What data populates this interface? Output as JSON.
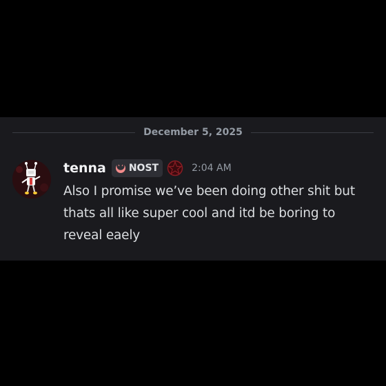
{
  "divider": {
    "date": "December 5, 2025"
  },
  "message": {
    "author": "tenna",
    "tag": {
      "label": "NOST",
      "icon": "crescent-moon-icon"
    },
    "role_icon": "pentagram-icon",
    "timestamp": "2:04 AM",
    "content": "Also I promise we’ve been doing other shit but thats all like super cool and itd be boring to reveal eaely"
  },
  "colors": {
    "background": "#000000",
    "panel": "#1a1a1e",
    "username": "#f2f3f5",
    "text": "#dbdee1",
    "muted": "#949ba4",
    "tag_bg": "#2e2f35",
    "tag_icon": "#f28b8b",
    "role_icon": "#8b1d24"
  }
}
